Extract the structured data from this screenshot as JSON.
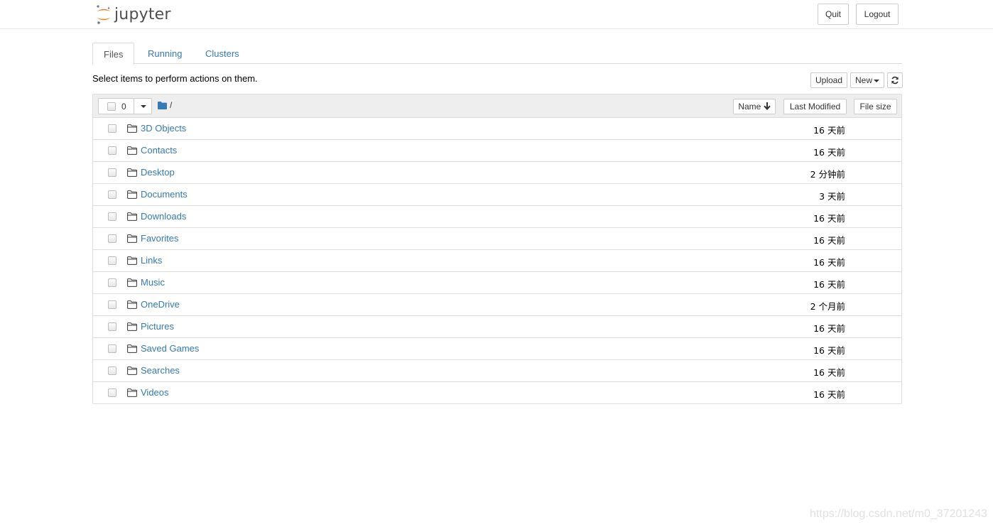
{
  "app": {
    "logo_text": "jupyter"
  },
  "header": {
    "quit_label": "Quit",
    "logout_label": "Logout"
  },
  "tabs": [
    {
      "label": "Files",
      "active": true
    },
    {
      "label": "Running",
      "active": false
    },
    {
      "label": "Clusters",
      "active": false
    }
  ],
  "instructions": "Select items to perform actions on them.",
  "toolbar": {
    "upload_label": "Upload",
    "new_label": "New",
    "refresh_icon": "refresh-icon"
  },
  "list_header": {
    "selected_count": "0",
    "breadcrumb": "/",
    "sort_name_label": "Name",
    "sort_modified_label": "Last Modified",
    "sort_size_label": "File size"
  },
  "items": [
    {
      "name": "3D Objects",
      "modified": "16 天前"
    },
    {
      "name": "Contacts",
      "modified": "16 天前"
    },
    {
      "name": "Desktop",
      "modified": "2 分钟前"
    },
    {
      "name": "Documents",
      "modified": "3 天前"
    },
    {
      "name": "Downloads",
      "modified": "16 天前"
    },
    {
      "name": "Favorites",
      "modified": "16 天前"
    },
    {
      "name": "Links",
      "modified": "16 天前"
    },
    {
      "name": "Music",
      "modified": "16 天前"
    },
    {
      "name": "OneDrive",
      "modified": "2 个月前"
    },
    {
      "name": "Pictures",
      "modified": "16 天前"
    },
    {
      "name": "Saved Games",
      "modified": "16 天前"
    },
    {
      "name": "Searches",
      "modified": "16 天前"
    },
    {
      "name": "Videos",
      "modified": "16 天前"
    }
  ],
  "watermark": "https://blog.csdn.net/m0_37201243",
  "colors": {
    "link": "#337ab7",
    "logo_orange": "#f37726",
    "header_gray": "#eeeeee"
  }
}
